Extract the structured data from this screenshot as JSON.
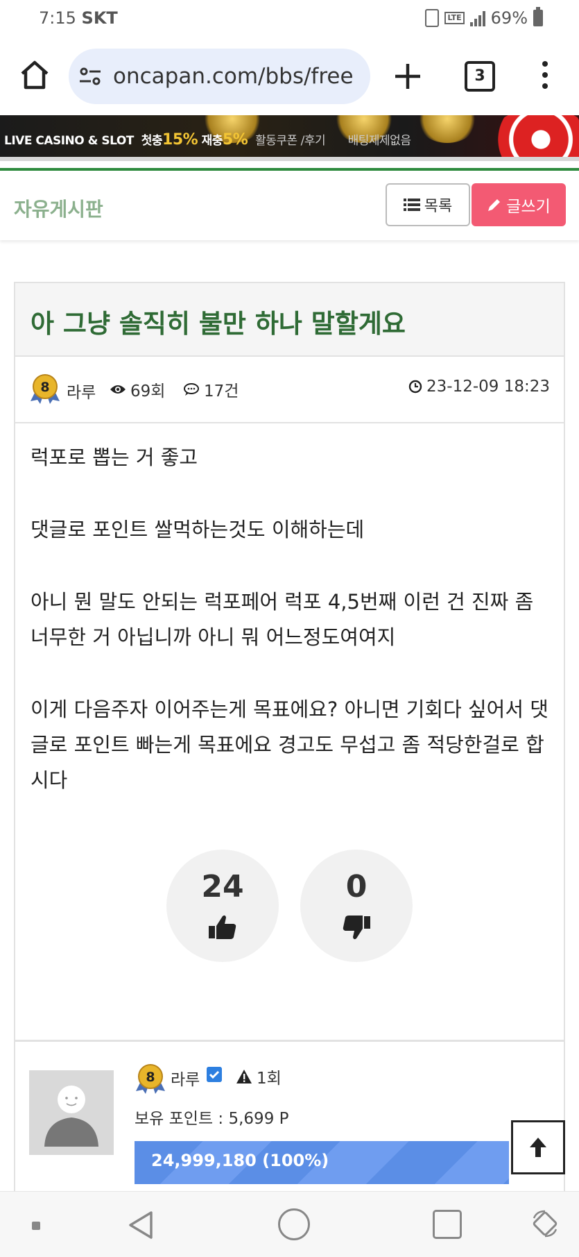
{
  "status_bar": {
    "time": "7:15",
    "carrier": "SKT",
    "network": "LTE",
    "battery": "69%"
  },
  "browser": {
    "url": "oncapan.com/bbs/free",
    "tab_count": "3"
  },
  "banner": {
    "text_main": "LIVE CASINO & SLOT",
    "bonus1_prefix": "첫충",
    "bonus1": "15%",
    "bonus2_prefix": "재충",
    "bonus2": "5%",
    "extra": "활동쿠폰 /후기",
    "extra2": "배팅제제없음"
  },
  "board": {
    "title": "자유게시판",
    "list_button": "목록",
    "write_button": "글쓰기"
  },
  "post": {
    "title": "아 그냥 솔직히 불만 하나 말할게요",
    "level": "8",
    "author": "라루",
    "views": "69회",
    "comments": "17건",
    "date": "23-12-09 18:23",
    "body": [
      "럭포로 뽑는 거 좋고",
      "댓글로 포인트 쌀먹하는것도 이해하는데",
      "아니 뭔 말도 안되는 럭포페어 럭포 4,5번째 이런 건 진짜 좀 너무한 거 아닙니까 아니 뭐 어느정도여여지",
      "이게 다음주자 이어주는게 목표에요? 아니면 기회다 싶어서 댓글로 포인트 빠는게 목표에요 경고도 무섭고 좀 적당한걸로 합시다"
    ],
    "likes": "24",
    "dislikes": "0"
  },
  "author_profile": {
    "level": "8",
    "name": "라루",
    "warnings": "1회",
    "points_label": "보유 포인트 : 5,699 P",
    "xp": "24,999,180 (100%)",
    "xp_percent": 100
  },
  "colors": {
    "board_title": "#8bb08d",
    "post_title": "#2f6b35",
    "write_button": "#f35a73",
    "xp_bar": "#5b8ee6"
  }
}
